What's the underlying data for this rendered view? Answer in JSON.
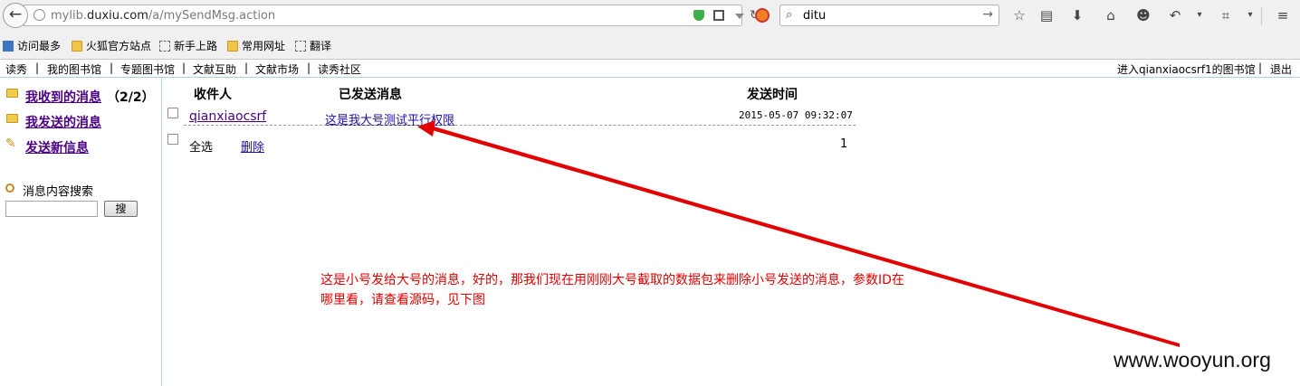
{
  "browser": {
    "url_prefix": "mylib.",
    "url_domain": "duxiu.com",
    "url_path": "/a/mySendMsg.action",
    "search_value": "ditu",
    "bookmarks": [
      "访问最多",
      "火狐官方站点",
      "新手上路",
      "常用网址",
      "翻译"
    ],
    "toolbar_icons": [
      "star-icon",
      "reading-list-icon",
      "download-icon",
      "home-icon",
      "chat-icon",
      "undo-icon",
      "crop-icon",
      "menu-icon"
    ]
  },
  "topnav": {
    "items": [
      "读秀",
      "我的图书馆",
      "专题图书馆",
      "文献互助",
      "文献市场",
      "读秀社区"
    ],
    "enter_library": "进入qianxiaocsrf1的图书馆",
    "logout": "退出"
  },
  "sidebar": {
    "received": "我收到的消息",
    "received_count": "（2/2）",
    "sent": "我发送的消息",
    "new_message": "发送新信息",
    "search_label": "消息内容搜索",
    "search_button": "搜"
  },
  "table": {
    "headers": [
      "收件人",
      "已发送消息",
      "发送时间"
    ],
    "rows": [
      {
        "recipient": "qianxiaocsrf",
        "subject": "这是我大号测试平行权限",
        "time": "2015-05-07 09:32:07"
      }
    ],
    "select_all": "全选",
    "delete": "删除",
    "page": "1"
  },
  "annotation": {
    "line1": "这是小号发给大号的消息，好的，那我们现在用刚刚大号截取的数据包来删除小号发送的消息，参数ID在",
    "line2": "哪里看，请查看源码，见下图",
    "arrow_color": "#e20000"
  },
  "watermark": "www.wooyun.org"
}
